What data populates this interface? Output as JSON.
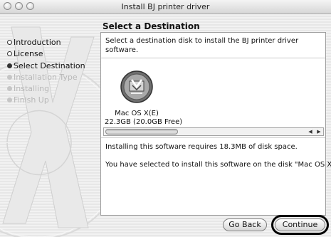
{
  "window": {
    "title": "Install BJ printer driver"
  },
  "sidebar": {
    "steps": [
      {
        "label": "Introduction",
        "state": "completed"
      },
      {
        "label": "License",
        "state": "completed"
      },
      {
        "label": "Select Destination",
        "state": "current"
      },
      {
        "label": "Installation Type",
        "state": "pending"
      },
      {
        "label": "Installing",
        "state": "pending"
      },
      {
        "label": "Finish Up",
        "state": "pending"
      }
    ]
  },
  "main": {
    "heading": "Select a Destination",
    "description": "Select a destination disk to install the BJ printer driver software.",
    "disk": {
      "name": "Mac OS X(E)",
      "size": "22.3GB (20.0GB Free)"
    },
    "messages": {
      "requirement": "Installing this software requires 18.3MB of disk space.",
      "selection": "You have selected to install this software on the disk \"Mac OS X(E).\""
    }
  },
  "buttons": {
    "back": "Go Back",
    "continue": "Continue"
  },
  "colors": {
    "window_bg": "#ececec",
    "panel_bg": "#ffffff",
    "highlight_ring": "#000000"
  }
}
